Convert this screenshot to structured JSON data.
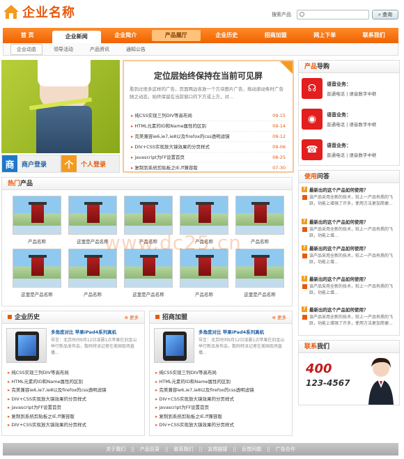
{
  "header": {
    "logo_text": "企业名称",
    "search_label": "搜索产品",
    "search_button": "查询"
  },
  "nav": {
    "items": [
      {
        "label": "首 页"
      },
      {
        "label": "企业新闻"
      },
      {
        "label": "企业简介"
      },
      {
        "label": "产品展厅"
      },
      {
        "label": "企业历史"
      },
      {
        "label": "招商加盟"
      },
      {
        "label": "网上下单"
      },
      {
        "label": "联系我们"
      }
    ],
    "sub_items": [
      {
        "label": "企业动态"
      },
      {
        "label": "领导活动"
      },
      {
        "label": "产品资讯"
      },
      {
        "label": "通知公告"
      }
    ]
  },
  "login": {
    "member_icon": "商",
    "member_label": "商户登录",
    "personal_icon": "个",
    "personal_label": "个人登录"
  },
  "news": {
    "badge": "NEW",
    "title": "定位层始终保持在当前可见屏",
    "desc": "看到过很多这样的广告，页面两边各放一个方块图片广告，拖动滚动条时广告随之动态，始终保留在当前窗口的下方或上方，对...",
    "items": [
      {
        "title": "纯CSS实现三列DIV等高布局",
        "date": "09-15"
      },
      {
        "title": "HTML元素的ID和Name属性的区别",
        "date": "09-14"
      },
      {
        "title": "完美兼容ie6,ie7,ie8以及firefox的css透明滤镜",
        "date": "09-12"
      },
      {
        "title": "DIV+CSS实现放大镜效果的分页样式",
        "date": "09-06"
      },
      {
        "title": "javascript为FF设置首页",
        "date": "08-25"
      },
      {
        "title": "复制到系统剪贴板之IE,ff兼容版",
        "date": "07-30"
      }
    ]
  },
  "hot_products": {
    "title_o": "热门",
    "title_b": "产品",
    "items": [
      {
        "caption": "产品名称"
      },
      {
        "caption": "这里是产品名称"
      },
      {
        "caption": "产品名称"
      },
      {
        "caption": "产品名称"
      },
      {
        "caption": "产品名称"
      },
      {
        "caption": "这里是产品名称"
      },
      {
        "caption": "产品名称"
      },
      {
        "caption": "这里是产品名称"
      },
      {
        "caption": "产品名称"
      },
      {
        "caption": "这里是产品名称"
      }
    ]
  },
  "watermark": "www.dc25.cn",
  "history": {
    "title": "企业历史",
    "more": "更多",
    "feat_title": "多角度对比 苹果iPad4系列真机",
    "feat_desc": "导言：北京时间9月12日凌晨1点苹果在旧金山举行新品发布会，数码特派记者在美国现场直播...",
    "items": [
      "纯CSS实现三列DIV等高布局",
      "HTML元素的ID和Name属性的区别",
      "完美兼容ie6,ie7,ie8以及firefox的css透明滤镜",
      "DIV+CSS实现放大镜效果的分页样式",
      "javascript为FF设置首页",
      "复制到系统剪贴板之IE,ff兼容版",
      "DIV+CSS实现放大镜效果的分页样式"
    ]
  },
  "join": {
    "title": "招商加盟",
    "more": "更多",
    "feat_title": "多角度对比 苹果iPad4系列真机",
    "feat_desc": "导言：北京时间9月12日凌晨1点苹果在旧金山举行新品发布会，数码特派记者在美国现场直播...",
    "items": [
      "纯CSS实现三列DIV等高布局",
      "HTML元素的ID和Name属性的区别",
      "完美兼容ie6,ie7,ie8以及firefox的css透明滤镜",
      "DIV+CSS实现放大镜效果的分页样式",
      "javascript为FF设置首页",
      "复制到系统剪贴板之IE,ff兼容版",
      "DIV+CSS实现放大镜效果的分页样式"
    ]
  },
  "guide": {
    "title_o": "产品",
    "title_b": "导购",
    "services": [
      {
        "icon": "headset-icon",
        "glyph": "☊",
        "name": "语音业务：",
        "desc": "普通电话 | 语音数字中继"
      },
      {
        "icon": "disc-icon",
        "glyph": "◉",
        "name": "语音业务：",
        "desc": "普通电话 | 语音数字中继"
      },
      {
        "icon": "phone-icon",
        "glyph": "☎",
        "name": "语音业务：",
        "desc": "普通电话 | 语音数字中继"
      }
    ]
  },
  "faq": {
    "title_o": "使用",
    "title_b": "问答",
    "items": [
      {
        "q": "最新出的这个产品如何使用？",
        "a": "该产品采用全新的技术，较上一产品有质的飞跃，功能上增强了许多，使用方法更加简便..."
      },
      {
        "q": "最新出的这个产品如何使用？",
        "a": "该产品采用全新的技术，较上一产品有质的飞跃，功能上增..."
      },
      {
        "q": "最新出的这个产品如何使用？",
        "a": "该产品采用全新的技术，较上一产品有质的飞跃，功能上增..."
      },
      {
        "q": "最新出的这个产品如何使用？",
        "a": "该产品采用全新的技术，较上一产品有质的飞跃，功能上增..."
      },
      {
        "q": "最新出的这个产品如何使用？",
        "a": "该产品采用全新的技术，较上一产品有质的飞跃，功能上增强了许多，使用方法更加简便..."
      }
    ]
  },
  "contact": {
    "title_o": "联系",
    "title_b": "我们",
    "tel_prefix": "400",
    "tel_number": "123-4567"
  },
  "footer": {
    "items": [
      "关于我们",
      "产品目录",
      "联系我们",
      "友情链接",
      "反馈问题",
      "广告合作"
    ],
    "sep": "||"
  },
  "colors": {
    "accent": "#e8590c",
    "nav": "#f57a14",
    "icon_red": "#e21e1e"
  }
}
